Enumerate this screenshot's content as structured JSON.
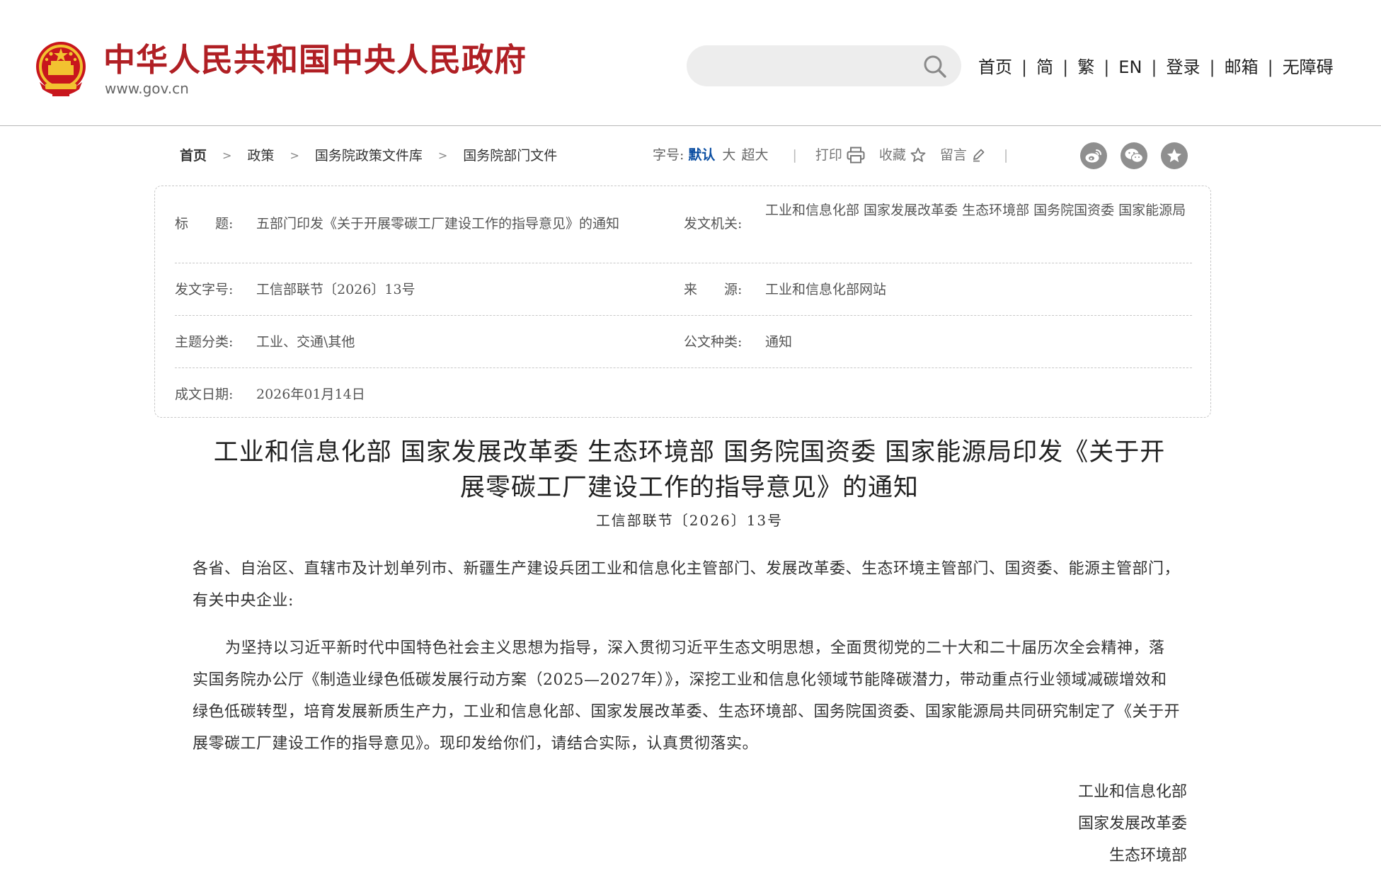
{
  "header": {
    "site_name": "中华人民共和国中央人民政府",
    "site_url": "www.gov.cn",
    "search": {
      "placeholder": ""
    },
    "nav": [
      "首页",
      "简",
      "繁",
      "EN",
      "登录",
      "邮箱",
      "无障碍"
    ],
    "nav_separator": "|"
  },
  "breadcrumb": {
    "items": [
      "首页",
      "政策",
      "国务院政策文件库",
      "国务院部门文件"
    ],
    "arrow": ">"
  },
  "tools": {
    "font_size_label": "字号:",
    "font_default": "默认",
    "font_large": "大",
    "font_xlarge": "超大",
    "separator": "|",
    "print_label": "打印",
    "favorite_label": "收藏",
    "comment_label": "留言"
  },
  "info": {
    "title_label": "标　　题:",
    "title_value": "五部门印发《关于开展零碳工厂建设工作的指导意见》的通知",
    "issuer_label": "发文机关:",
    "issuer_value": "工业和信息化部 国家发展改革委 生态环境部 国务院国资委 国家能源局",
    "doc_no_label": "发文字号:",
    "doc_no_value": "工信部联节〔2026〕13号",
    "source_label": "来　　源:",
    "source_value": "工业和信息化部网站",
    "topic_label": "主题分类:",
    "topic_value": "工业、交通\\其他",
    "doc_type_label": "公文种类:",
    "doc_type_value": "通知",
    "date_label": "成文日期:",
    "date_value": "2026年01月14日"
  },
  "article": {
    "title_line1": "工业和信息化部 国家发展改革委 生态环境部 国务院国资委 国家能源局印发《关于开",
    "title_line2": "展零碳工厂建设工作的指导意见》的通知",
    "doc_number": "工信部联节〔2026〕13号",
    "salutation": "各省、自治区、直辖市及计划单列市、新疆生产建设兵团工业和信息化主管部门、发展改革委、生态环境主管部门、国资委、能源主管部门，有关中央企业:",
    "body": "为坚持以习近平新时代中国特色社会主义思想为指导，深入贯彻习近平生态文明思想，全面贯彻党的二十大和二十届历次全会精神，落实国务院办公厅《制造业绿色低碳发展行动方案（2025—2027年）》，深挖工业和信息化领域节能降碳潜力，带动重点行业领域减碳增效和绿色低碳转型，培育发展新质生产力，工业和信息化部、国家发展改革委、生态环境部、国务院国资委、国家能源局共同研究制定了《关于开展零碳工厂建设工作的指导意见》。现印发给你们，请结合实际，认真贯彻落实。",
    "signatures": [
      "工业和信息化部",
      "国家发展改革委",
      "生态环境部"
    ]
  },
  "colors": {
    "brand_red": "#b01f24",
    "link_blue": "#0b4ea2",
    "share_icon_gray": "#8f8f8f"
  },
  "icons": [
    "national-emblem",
    "search-icon",
    "printer-icon",
    "star-icon",
    "pencil-icon",
    "weibo-icon",
    "wechat-icon",
    "favorite-share-icon"
  ]
}
